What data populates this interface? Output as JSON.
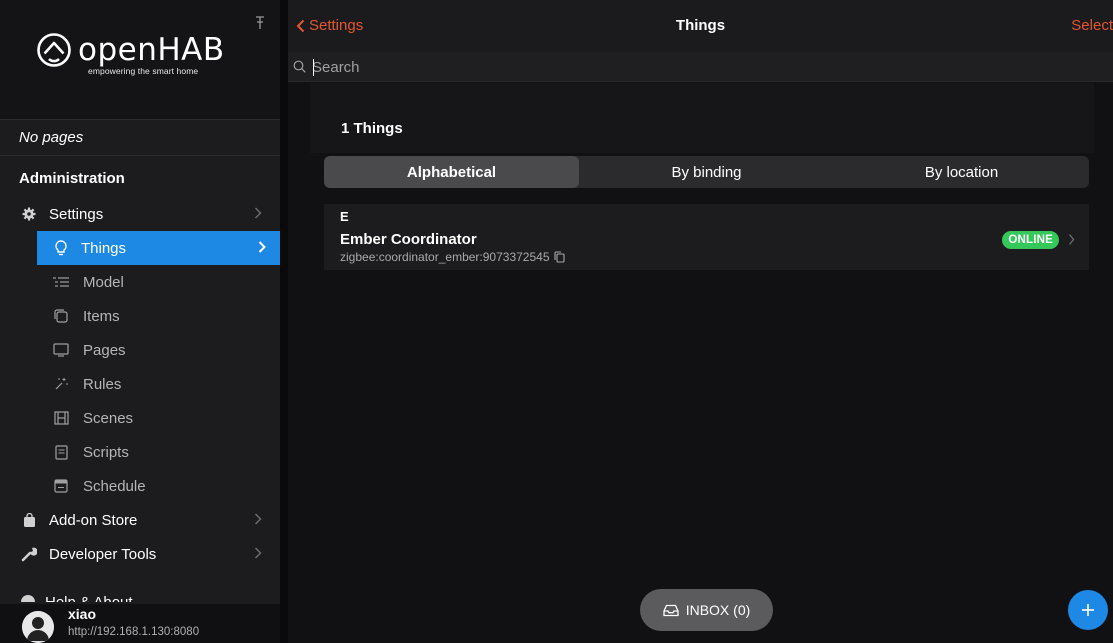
{
  "sidebar": {
    "logo_word": "openHAB",
    "logo_tagline": "empowering the smart home",
    "no_pages": "No pages",
    "admin_title": "Administration",
    "items": [
      {
        "label": "Settings",
        "icon": "gear-icon"
      },
      {
        "label": "Things",
        "icon": "lightbulb-icon"
      },
      {
        "label": "Model",
        "icon": "list-icon"
      },
      {
        "label": "Items",
        "icon": "square-stack-icon"
      },
      {
        "label": "Pages",
        "icon": "display-icon"
      },
      {
        "label": "Rules",
        "icon": "wand-icon"
      },
      {
        "label": "Scenes",
        "icon": "film-icon"
      },
      {
        "label": "Scripts",
        "icon": "doc-icon"
      },
      {
        "label": "Schedule",
        "icon": "calendar-icon"
      },
      {
        "label": "Add-on Store",
        "icon": "bag-icon"
      },
      {
        "label": "Developer Tools",
        "icon": "wrench-icon"
      },
      {
        "label": "Help & About",
        "icon": "question-icon"
      }
    ],
    "user": {
      "name": "xiao",
      "url": "http://192.168.1.130:8080"
    }
  },
  "header": {
    "back_label": "Settings",
    "title": "Things",
    "select_label": "Select"
  },
  "search": {
    "placeholder": "Search",
    "value": ""
  },
  "main": {
    "count_label": "1 Things",
    "tabs": [
      "Alphabetical",
      "By binding",
      "By location"
    ],
    "group_letter": "E",
    "thing": {
      "label": "Ember Coordinator",
      "uid": "zigbee:coordinator_ember:9073372545",
      "status": "ONLINE"
    },
    "inbox_label": "INBOX (0)"
  },
  "colors": {
    "accent": "#1e88e5",
    "link": "#e4572e",
    "online": "#34c759"
  }
}
